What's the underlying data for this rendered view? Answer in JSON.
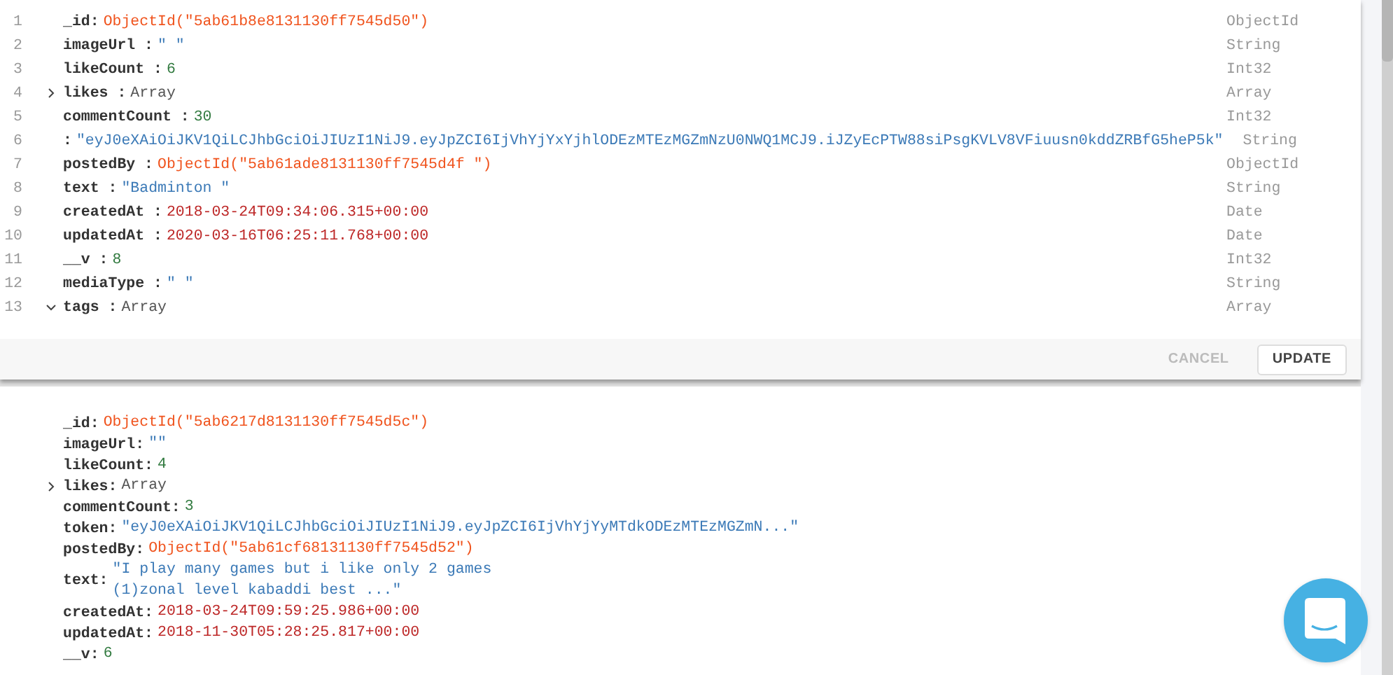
{
  "editor": {
    "fields": [
      {
        "line": "1",
        "key": "_id:",
        "value": "ObjectId(\"5ab61b8e8131130ff7545d50\")",
        "kind": "objectid",
        "type": "ObjectId"
      },
      {
        "line": "2",
        "key": "imageUrl :",
        "value": "\"  \"",
        "kind": "string",
        "type": "String"
      },
      {
        "line": "3",
        "key": "likeCount :",
        "value": "6",
        "kind": "number",
        "type": "Int32"
      },
      {
        "line": "4",
        "key": "likes :",
        "value": "Array",
        "kind": "array",
        "type": "Array",
        "expanded": false
      },
      {
        "line": "5",
        "key": "commentCount :",
        "value": "30",
        "kind": "number",
        "type": "Int32"
      },
      {
        "line": "6",
        "key": ":",
        "value": "\"eyJ0eXAiOiJKV1QiLCJhbGciOiJIUzI1NiJ9.eyJpZCI6IjVhYjYxYjhlODEzMTEzMGZmNzU0NWQ1MCJ9.iJZyEcPTW88siPsgKVLV8VFiuusn0kddZRBfG5heP5k\"",
        "kind": "string",
        "type": "String"
      },
      {
        "line": "7",
        "key": "postedBy :",
        "value": "ObjectId(\"5ab61ade8131130ff7545d4f \")",
        "kind": "objectid",
        "type": "ObjectId"
      },
      {
        "line": "8",
        "key": "text :",
        "value": "\"Badminton \"",
        "kind": "string",
        "type": "String"
      },
      {
        "line": "9",
        "key": "createdAt :",
        "value": "2018-03-24T09:34:06.315+00:00",
        "kind": "date",
        "type": "Date"
      },
      {
        "line": "10",
        "key": "updatedAt :",
        "value": "2020-03-16T06:25:11.768+00:00",
        "kind": "date",
        "type": "Date"
      },
      {
        "line": "11",
        "key": "__v :",
        "value": "8",
        "kind": "number",
        "type": "Int32"
      },
      {
        "line": "12",
        "key": "mediaType :",
        "value": "\"  \"",
        "kind": "string",
        "type": "String"
      },
      {
        "line": "13",
        "key": "tags :",
        "value": "Array",
        "kind": "array",
        "type": "Array",
        "expanded": true
      }
    ],
    "buttons": [
      {
        "label": "CANCEL",
        "disabled": true
      },
      {
        "label": "UPDATE",
        "disabled": false
      }
    ]
  },
  "document": {
    "fields": [
      {
        "key": "_id:",
        "value": "ObjectId(\"5ab6217d8131130ff7545d5c\")",
        "kind": "objectid"
      },
      {
        "key": "imageUrl:",
        "value": "\"\"",
        "kind": "string"
      },
      {
        "key": "likeCount:",
        "value": "4",
        "kind": "number"
      },
      {
        "key": "likes:",
        "value": "Array",
        "kind": "array",
        "expanded": false
      },
      {
        "key": "commentCount:",
        "value": "3",
        "kind": "number"
      },
      {
        "key": "token:",
        "value": "\"eyJ0eXAiOiJKV1QiLCJhbGciOiJIUzI1NiJ9.eyJpZCI6IjVhYjYyMTdkODEzMTEzMGZmN...\"",
        "kind": "string"
      },
      {
        "key": "postedBy:",
        "value": "ObjectId(\"5ab61cf68131130ff7545d52\")",
        "kind": "objectid"
      },
      {
        "key": "text:",
        "value": "\"I play many games but i like only 2 games\n(1)zonal level kabaddi best ...\"",
        "kind": "string"
      },
      {
        "key": "createdAt:",
        "value": "2018-03-24T09:59:25.986+00:00",
        "kind": "date"
      },
      {
        "key": "updatedAt:",
        "value": "2018-11-30T05:28:25.817+00:00",
        "kind": "date"
      },
      {
        "key": "__v:",
        "value": "6",
        "kind": "number"
      }
    ]
  }
}
